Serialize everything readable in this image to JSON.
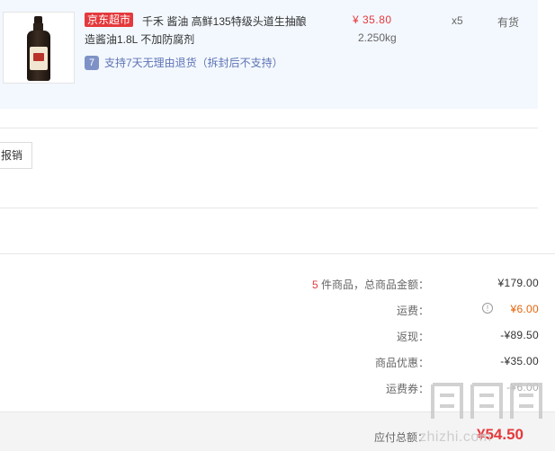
{
  "product": {
    "badge": "京东超市",
    "title": "千禾 酱油 高鲜135特级头道生抽酿造酱油1.8L 不加防腐剂",
    "price": "¥ 35.80",
    "weight": "2.250kg",
    "quantity": "x5",
    "stock_status": "有货",
    "return_badge": "7",
    "return_policy": "支持7天无理由退货（拆封后不支持）",
    "thumbnail_icon": "soy-sauce-bottle-image"
  },
  "actions": {
    "reimburse_label": "报销"
  },
  "summary": {
    "item_count": "5",
    "item_count_label": "件商品，总商品金额：",
    "goods_total": "¥179.00",
    "shipping_label": "运费：",
    "shipping_info_icon": "info-icon",
    "shipping_value": "¥6.00",
    "cashback_label": "返现：",
    "cashback_value": "-¥89.50",
    "discount_label": "商品优惠：",
    "discount_value": "-¥35.00",
    "coupon_label": "运费券：",
    "coupon_value": "-¥6.00",
    "payable_label": "应付总额：",
    "payable_value": "¥54.50"
  },
  "watermark": {
    "text": "zhizhi.com"
  },
  "colors": {
    "accent_red": "#e4393c",
    "shipping_orange": "#e4640a",
    "product_bg": "#f3f8fe",
    "return_blue": "#5e73b5"
  }
}
